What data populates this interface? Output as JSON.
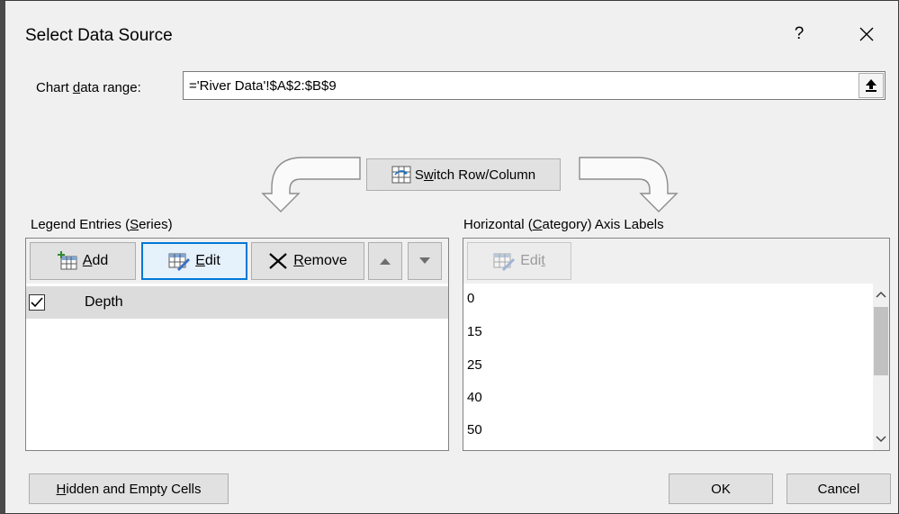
{
  "dialog": {
    "title": "Select Data Source",
    "help_label": "?",
    "close_icon": "close-icon"
  },
  "range": {
    "label_pre": "Chart ",
    "label_ul": "d",
    "label_post": "ata range:",
    "value": "='River Data'!$A$2:$B$9",
    "collapse_icon": "collapse-upload-icon"
  },
  "switch": {
    "label_pre": "S",
    "label_ul": "w",
    "label_post": "itch Row/Column",
    "icon": "switch-row-column-icon"
  },
  "legend": {
    "label_pre": "Legend Entries (",
    "label_ul": "S",
    "label_post": "eries)",
    "add_ul": "A",
    "add_post": "dd",
    "edit_ul": "E",
    "edit_post": "dit",
    "remove_ul": "R",
    "remove_post": "emove",
    "series": [
      {
        "name": "Depth",
        "checked": true
      }
    ]
  },
  "axis": {
    "label_pre": "Horizontal (",
    "label_ul": "C",
    "label_post": "ategory) Axis Labels",
    "edit_pre": "Edi",
    "edit_ul": "t",
    "categories": [
      "0",
      "15",
      "25",
      "40",
      "50"
    ]
  },
  "footer": {
    "hidden_ul": "H",
    "hidden_post": "idden and Empty Cells",
    "ok_label": "OK",
    "cancel_label": "Cancel"
  },
  "colors": {
    "selection_border": "#0078d7",
    "selected_row": "#dcdcdc",
    "dialog_bg": "#f0f0f0"
  }
}
